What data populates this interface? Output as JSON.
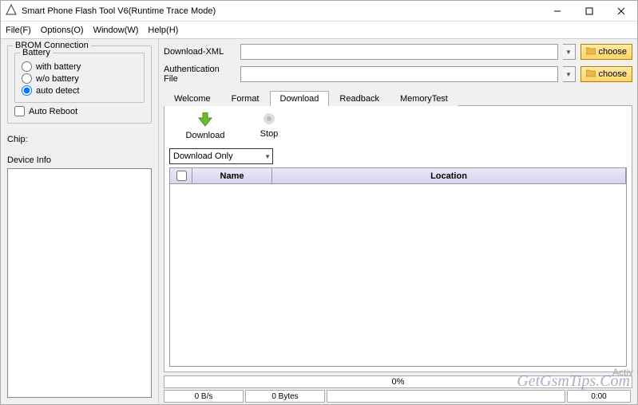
{
  "title": "Smart Phone Flash Tool V6(Runtime Trace Mode)",
  "menu": {
    "file": "File(F)",
    "options": "Options(O)",
    "window": "Window(W)",
    "help": "Help(H)"
  },
  "left": {
    "brom_group": "BROM Connection",
    "battery_group": "Battery",
    "radios": {
      "with": "with battery",
      "without": "w/o battery",
      "auto": "auto detect"
    },
    "auto_reboot": "Auto Reboot",
    "chip_label": "Chip:",
    "device_info": "Device Info"
  },
  "files": {
    "download_xml_label": "Download-XML",
    "auth_file_label": "Authentication File",
    "choose": "choose"
  },
  "tabs": {
    "welcome": "Welcome",
    "format": "Format",
    "download": "Download",
    "readback": "Readback",
    "memtest": "MemoryTest"
  },
  "toolbar": {
    "download": "Download",
    "stop": "Stop"
  },
  "dropdown": {
    "selected": "Download Only"
  },
  "table": {
    "name_header": "Name",
    "location_header": "Location"
  },
  "status": {
    "progress": "0%",
    "speed": "0 B/s",
    "bytes": "0 Bytes",
    "time": "0:00"
  },
  "watermark": "GetGsmTips.Com",
  "activate": "Activ"
}
